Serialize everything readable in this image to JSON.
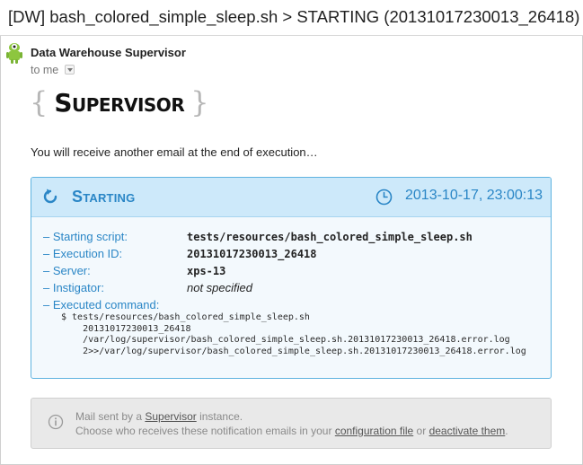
{
  "email": {
    "subject": "[DW] bash_colored_simple_sleep.sh > STARTING (20131017230013_26418)",
    "sender": "Data Warehouse Supervisor",
    "recipient_label": "to me",
    "avatar_icon": "android-robot-icon"
  },
  "logo": {
    "brace_open": "{",
    "word": "Supervisor",
    "brace_close": "}"
  },
  "intro_text": "You will receive another email at the end of execution…",
  "card": {
    "status": "Starting",
    "status_icon": "restart-icon",
    "clock_icon": "clock-icon",
    "datetime": "2013-10-17, 23:00:13",
    "accent_color": "#2a86c6",
    "fields": [
      {
        "label": "– Starting script:",
        "value": "tests/resources/bash_colored_simple_sleep.sh"
      },
      {
        "label": "– Execution ID:",
        "value": "20131017230013_26418"
      },
      {
        "label": "– Server:",
        "value": "xps-13"
      },
      {
        "label": "– Instigator:",
        "value": "not specified"
      }
    ],
    "command_label": "– Executed command:",
    "command_lines": [
      "$ tests/resources/bash_colored_simple_sleep.sh",
      "    20131017230013_26418",
      "    /var/log/supervisor/bash_colored_simple_sleep.sh.20131017230013_26418.error.log",
      "    2>>/var/log/supervisor/bash_colored_simple_sleep.sh.20131017230013_26418.error.log"
    ]
  },
  "footer": {
    "info_icon": "info-icon",
    "line1_prefix": "Mail sent by a ",
    "line1_link": "Supervisor",
    "line1_suffix": " instance.",
    "line2_prefix": "Choose who receives these notification emails in your ",
    "line2_link1": "configuration file",
    "line2_mid": " or ",
    "line2_link2": "deactivate them",
    "line2_suffix": "."
  }
}
